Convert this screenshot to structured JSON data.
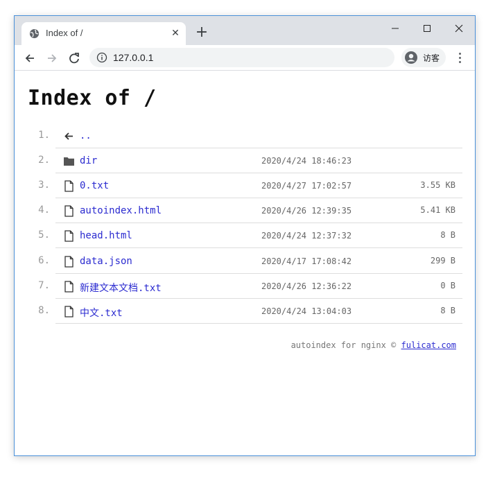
{
  "browser": {
    "tab_title": "Index of /",
    "url": "127.0.0.1",
    "profile_name": "访客",
    "new_tab_label": "+",
    "tab_close_label": "✕"
  },
  "page": {
    "title": "Index of /",
    "entries": [
      {
        "num": "1.",
        "name": "..",
        "type": "parent",
        "date": "",
        "size": ""
      },
      {
        "num": "2.",
        "name": "dir",
        "type": "folder",
        "date": "2020/4/24 18:46:23",
        "size": ""
      },
      {
        "num": "3.",
        "name": "0.txt",
        "type": "file",
        "date": "2020/4/27 17:02:57",
        "size": "3.55 KB"
      },
      {
        "num": "4.",
        "name": "autoindex.html",
        "type": "file",
        "date": "2020/4/26 12:39:35",
        "size": "5.41 KB"
      },
      {
        "num": "5.",
        "name": "head.html",
        "type": "file",
        "date": "2020/4/24 12:37:32",
        "size": "8 B"
      },
      {
        "num": "6.",
        "name": "data.json",
        "type": "file",
        "date": "2020/4/17 17:08:42",
        "size": "299 B"
      },
      {
        "num": "7.",
        "name": "新建文本文档.txt",
        "type": "file",
        "date": "2020/4/26 12:36:22",
        "size": "0 B"
      },
      {
        "num": "8.",
        "name": "中文.txt",
        "type": "file",
        "date": "2020/4/24 13:04:03",
        "size": "8 B"
      }
    ],
    "footer": {
      "text": "autoindex for nginx © ",
      "link_label": "fulicat.com"
    }
  },
  "colors": {
    "link": "#2b2bd0",
    "titlebar": "#dee1e6",
    "window_border": "#4a90d9"
  },
  "icons": {
    "tab": "globe-icon",
    "parent": "arrow-left-icon",
    "folder": "folder-icon",
    "file": "file-icon"
  }
}
